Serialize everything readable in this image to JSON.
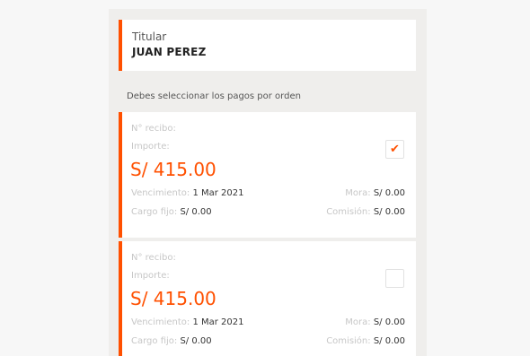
{
  "holder": {
    "label": "Titular",
    "name": "JUAN PEREZ"
  },
  "instruction": "Debes seleccionar los pagos por orden",
  "payments": [
    {
      "receipt_label": "N° recibo:",
      "importe_label": "Importe:",
      "amount": "S/ 415.00",
      "venc_label": "Vencimiento:",
      "venc_value": "1 Mar 2021",
      "mora_label": "Mora:",
      "mora_value": "S/ 0.00",
      "cargo_label": "Cargo fijo:",
      "cargo_value": "S/ 0.00",
      "comision_label": "Comisión:",
      "comision_value": "S/ 0.00",
      "selected": true,
      "check_icon": "checkmark"
    },
    {
      "receipt_label": "N° recibo:",
      "importe_label": "Importe:",
      "amount": "S/ 415.00",
      "venc_label": "Vencimiento:",
      "venc_value": "1 Mar 2021",
      "mora_label": "Mora:",
      "mora_value": "S/ 0.00",
      "cargo_label": "Cargo fijo:",
      "cargo_value": "S/ 0.00",
      "comision_label": "Comisión:",
      "comision_value": "S/ 0.00",
      "selected": false
    }
  ],
  "colors": {
    "accent": "#ff5000",
    "panel": "#efeeec",
    "background": "#f7f7f7"
  }
}
